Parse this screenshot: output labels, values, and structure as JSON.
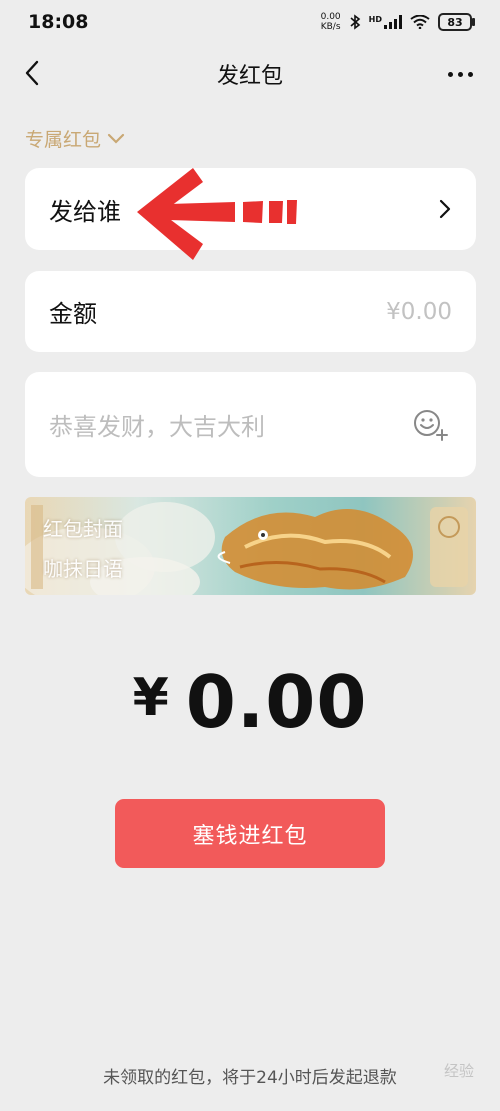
{
  "status_bar": {
    "time": "18:08",
    "net_speed_value": "0.00",
    "net_speed_unit": "KB/s",
    "network_label": "HD",
    "battery": "83",
    "icons": [
      "bluetooth-icon",
      "signal-icon",
      "wifi-icon",
      "battery-icon"
    ]
  },
  "header": {
    "title": "发红包",
    "back_icon": "chevron-left-icon",
    "more_icon": "more-dots-icon"
  },
  "packet_type": {
    "label": "专属红包",
    "icon": "chevron-down-icon"
  },
  "form": {
    "recipient_label": "发给谁",
    "amount_label": "金额",
    "amount_value": "¥0.00",
    "greeting_placeholder": "恭喜发财，大吉大利",
    "emoji_icon": "emoji-add-icon"
  },
  "cover": {
    "label": "红包封面",
    "name": "咖抹日语"
  },
  "total": {
    "currency": "¥",
    "value": "0.00"
  },
  "send_button": "塞钱进红包",
  "footer_note": "未领取的红包，将于24小时后发起退款",
  "watermark": "经验",
  "colors": {
    "background": "#ededed",
    "accent_gold": "#c9a874",
    "send_red": "#f25a5a",
    "annotation_arrow": "#e8302f"
  }
}
